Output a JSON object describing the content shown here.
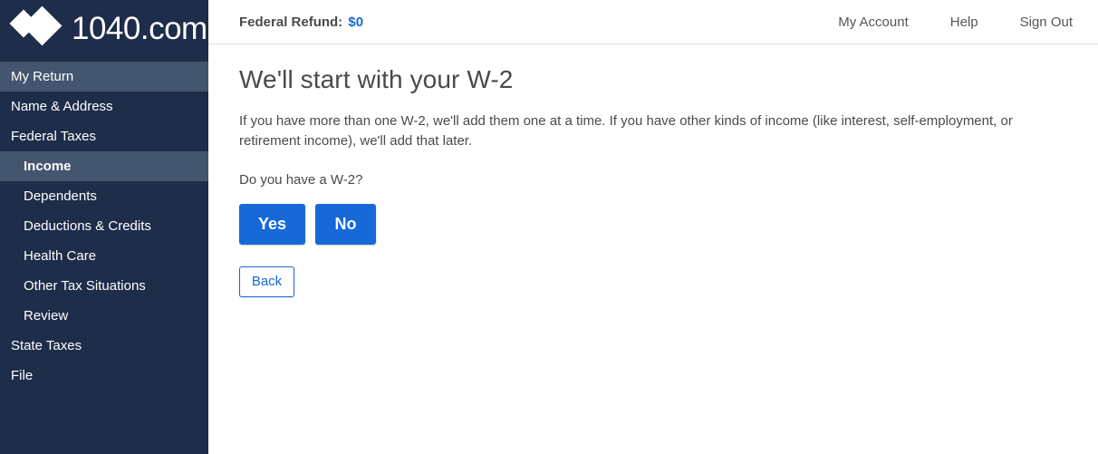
{
  "brand": {
    "name": "1040.com",
    "logo_icon": "double-diamond-logo-icon"
  },
  "sidebar": {
    "items": [
      {
        "label": "My Return",
        "level": "top",
        "state": "active"
      },
      {
        "label": "Name & Address",
        "level": "top",
        "state": "normal"
      },
      {
        "label": "Federal Taxes",
        "level": "top",
        "state": "normal"
      },
      {
        "label": "Income",
        "level": "sub",
        "state": "active-sub"
      },
      {
        "label": "Dependents",
        "level": "sub",
        "state": "normal"
      },
      {
        "label": "Deductions & Credits",
        "level": "sub",
        "state": "normal"
      },
      {
        "label": "Health Care",
        "level": "sub",
        "state": "normal"
      },
      {
        "label": "Other Tax Situations",
        "level": "sub",
        "state": "normal"
      },
      {
        "label": "Review",
        "level": "sub",
        "state": "normal"
      },
      {
        "label": "State Taxes",
        "level": "top",
        "state": "normal"
      },
      {
        "label": "File",
        "level": "top",
        "state": "normal"
      }
    ]
  },
  "header": {
    "refund_label": "Federal Refund:",
    "refund_amount": "$0",
    "nav": [
      {
        "label": "My Account"
      },
      {
        "label": "Help"
      },
      {
        "label": "Sign Out"
      }
    ]
  },
  "main": {
    "title": "We'll start with your W-2",
    "intro": "If you have more than one W-2, we'll add them one at a time. If you have other kinds of income (like interest, self-employment, or retirement income), we'll add that later.",
    "question": "Do you have a W-2?",
    "yes_label": "Yes",
    "no_label": "No",
    "back_label": "Back"
  },
  "colors": {
    "sidebar_bg": "#1e2d4a",
    "sidebar_active": "#44566f",
    "accent_blue": "#1669d6",
    "text_gray": "#4a4a4a",
    "border_gray": "#dddddd"
  }
}
